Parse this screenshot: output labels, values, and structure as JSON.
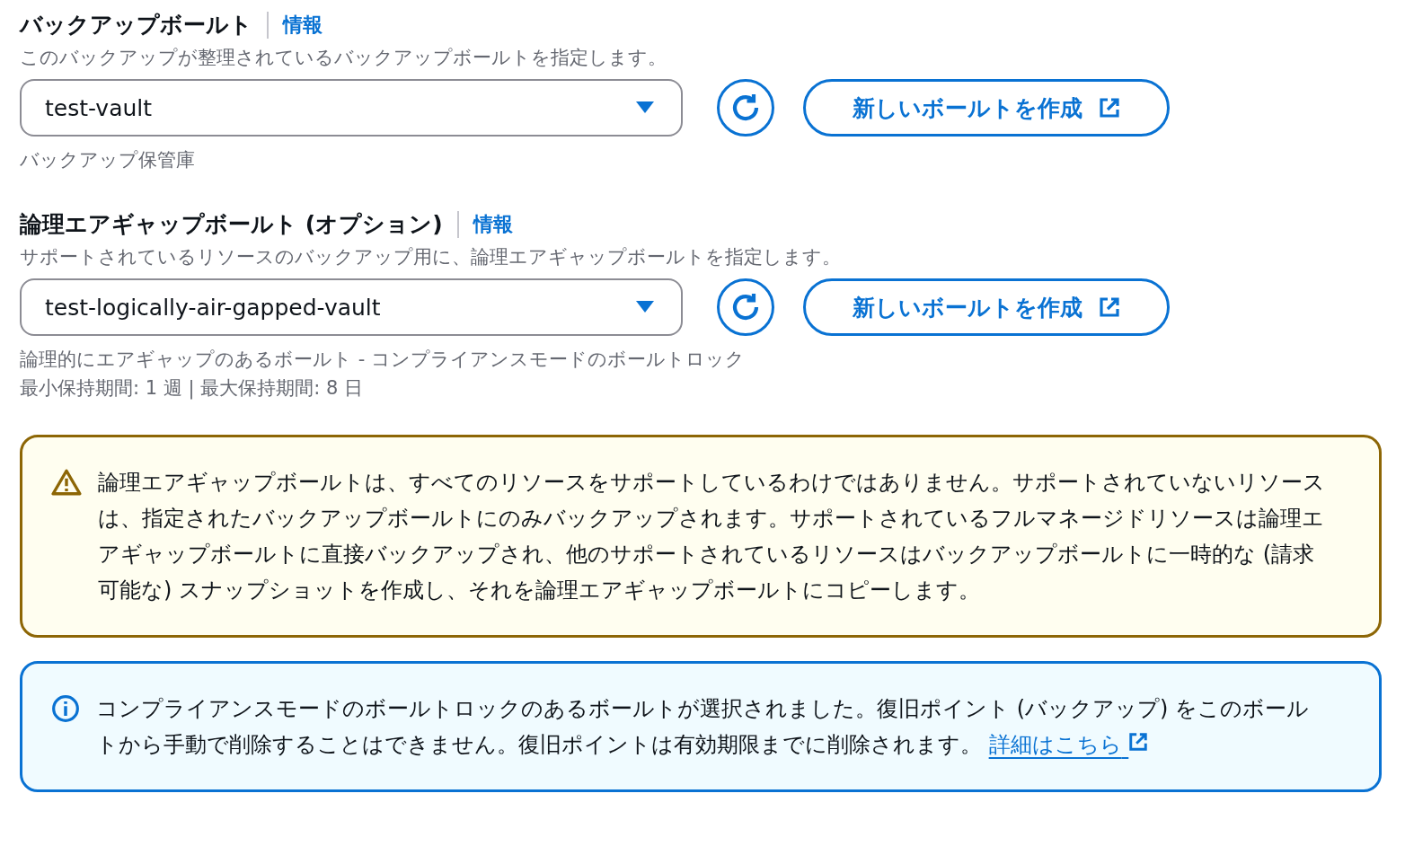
{
  "sections": [
    {
      "label": "バックアップボールト",
      "info": "情報",
      "description": "このバックアップが整理されているバックアップボールトを指定します。",
      "select": {
        "value": "test-vault"
      },
      "create_button": "新しいボールトを作成",
      "hints": [
        "バックアップ保管庫"
      ]
    },
    {
      "label": "論理エアギャップボールト (オプション)",
      "info": "情報",
      "description": "サポートされているリソースのバックアップ用に、論理エアギャップボールトを指定します。",
      "select": {
        "value": "test-logically-air-gapped-vault"
      },
      "create_button": "新しいボールトを作成",
      "hints": [
        "論理的にエアギャップのあるボールト - コンプライアンスモードのボールトロック",
        "最小保持期間: 1 週 | 最大保持期間: 8 日"
      ]
    }
  ],
  "alerts": [
    {
      "kind": "warning",
      "text": "論理エアギャップボールトは、すべてのリソースをサポートしているわけではありません。サポートされていないリソースは、指定されたバックアップボールトにのみバックアップされます。サポートされているフルマネージドリソースは論理エアギャップボールトに直接バックアップされ、他のサポートされているリソースはバックアップボールトに一時的な (請求可能な) スナップショットを作成し、それを論理エアギャップボールトにコピーします。"
    },
    {
      "kind": "info",
      "text": "コンプライアンスモードのボールトロックのあるボールトが選択されました。復旧ポイント (バックアップ) をこのボールトから手動で削除することはできません。復旧ポイントは有効期限までに削除されます。",
      "link": "詳細はこちら"
    }
  ]
}
